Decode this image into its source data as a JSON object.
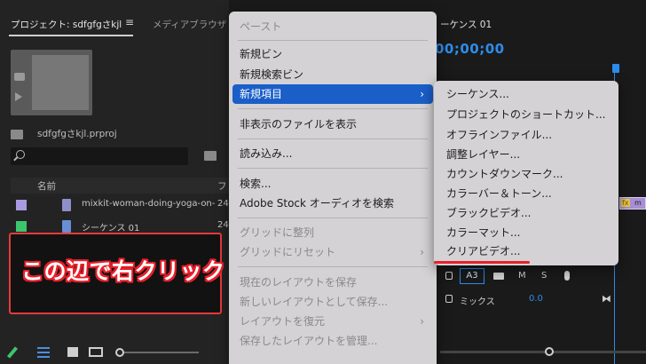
{
  "project_panel": {
    "tab_project": "プロジェクト: sdfgfgさkjl",
    "tab_menu_icon": "≡",
    "tab_media": "メディアブラウザ",
    "project_file": "sdfgfgさkjl.prproj",
    "columns": {
      "name": "名前",
      "f": "フ"
    },
    "rows": [
      {
        "name": "mixkit-woman-doing-yoga-on-",
        "num": "24",
        "color": "#a99ae0"
      },
      {
        "name": "シーケンス 01",
        "num": "24",
        "color": "#3ec46d"
      }
    ],
    "annotation": "この辺で右クリック"
  },
  "program_panel": {
    "sequence_tab": "ーケンス 01",
    "timecode": "00;00;00",
    "clip_fx": "fx",
    "clip_label": "m",
    "track_a3": {
      "label": "A3",
      "m": "M",
      "s": "S"
    },
    "mix": {
      "label": "ミックス",
      "value": "0.0"
    },
    "bowtie": "⧓"
  },
  "context_menu": {
    "paste": "ペースト",
    "new_bin": "新規ビン",
    "new_search_bin": "新規検索ビン",
    "new_item": "新規項目",
    "show_hidden": "非表示のファイルを表示",
    "import": "読み込み...",
    "search": "検索...",
    "adobe_stock": "Adobe Stock オーディオを検索",
    "align_grid": "グリッドに整列",
    "reset_grid": "グリッドにリセット",
    "save_layout": "現在のレイアウトを保存",
    "save_new_layout": "新しいレイアウトとして保存...",
    "restore_layout": "レイアウトを復元",
    "manage_layouts": "保存したレイアウトを管理...",
    "arrow": "›"
  },
  "submenu": {
    "items": [
      "シーケンス...",
      "プロジェクトのショートカット...",
      "オフラインファイル...",
      "調整レイヤー...",
      "カウントダウンマーク...",
      "カラーバー＆トーン...",
      "ブラックビデオ...",
      "カラーマット...",
      "クリアビデオ..."
    ]
  }
}
